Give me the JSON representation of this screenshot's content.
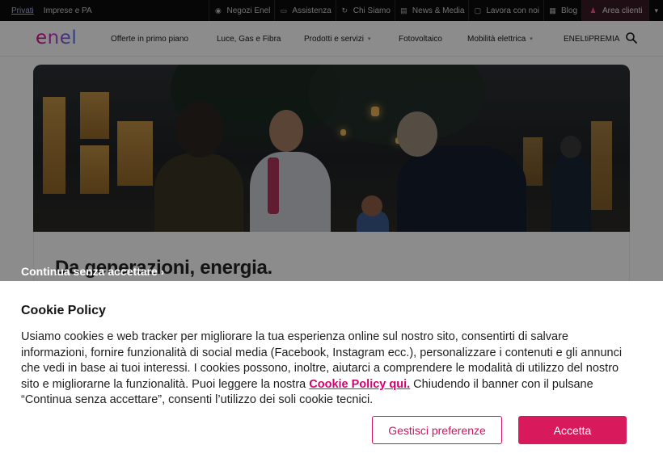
{
  "topbar": {
    "segment_private": "Privati",
    "segment_business": "Imprese e PA",
    "links": [
      {
        "icon": "location-pin-icon",
        "label": "Negozi Enel"
      },
      {
        "icon": "chat-icon",
        "label": "Assistenza"
      },
      {
        "icon": "refresh-icon",
        "label": "Chi Siamo"
      },
      {
        "icon": "newspaper-icon",
        "label": "News & Media"
      },
      {
        "icon": "briefcase-icon",
        "label": "Lavora con noi"
      },
      {
        "icon": "blog-icon",
        "label": "Blog"
      }
    ],
    "area_clienti": "Area clienti",
    "area_icon": "user-icon"
  },
  "nav": {
    "logo_text": "enel",
    "items": [
      {
        "label": "Offerte in primo piano",
        "has_dropdown": false
      },
      {
        "label": "Luce, Gas e Fibra",
        "has_dropdown": false
      },
      {
        "label": "Prodotti e servizi",
        "has_dropdown": true
      },
      {
        "label": "Fotovoltaico",
        "has_dropdown": false
      },
      {
        "label": "Mobilità elettrica",
        "has_dropdown": true
      },
      {
        "label": "ENELtiPREMIA",
        "has_dropdown": false
      }
    ],
    "search_icon": "search-icon"
  },
  "hero": {
    "headline": "Da generazioni, energia."
  },
  "overlay": {
    "continue_label": "Continua senza accettare",
    "continue_arrow": "›"
  },
  "cookie": {
    "title": "Cookie Policy",
    "body_before_link": "Usiamo cookies e web tracker per migliorare la tua esperienza online sul nostro sito, consentirti di salvare informazioni, fornire funzionalità di social media (Facebook, Instagram ecc.), personalizzare i contenuti e gli annunci che vedi in base ai tuoi interessi. I cookies possono, inoltre, aiutarci a comprendere le modalità di utilizzo del nostro sito e migliorarne la funzionalità. Puoi leggere la nostra ",
    "link_text": "Cookie Policy qui.",
    "body_after_link": " Chiudendo il banner con il pulsane “Continua senza accettare”, consenti l’utilizzo dei soli cookie tecnici.",
    "manage_label": "Gestisci preferenze",
    "accept_label": "Accetta"
  },
  "colors": {
    "brand_pink": "#d81a5c",
    "topbar_bg": "#0b0b0b",
    "link_pink": "#d6006e"
  }
}
